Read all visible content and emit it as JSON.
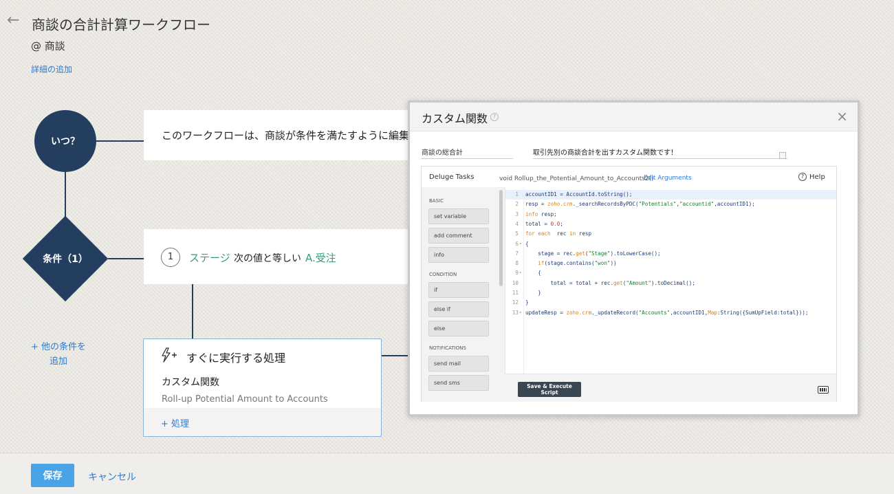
{
  "header": {
    "title": "商談の合計計算ワークフロー",
    "module": "@ 商談",
    "add_details": "詳細の追加"
  },
  "flow": {
    "when_label": "いつ？",
    "when_text": "このワークフローは、商談が条件を満たすように編集",
    "condition_label": "条件（1）",
    "condition": {
      "number": "1",
      "field": "ステージ",
      "operator": "次の値と等しい",
      "value": "A.受注"
    },
    "add_condition": [
      "+ 他の条件を",
      "追加"
    ],
    "action": {
      "title": "すぐに実行する処理",
      "type": "カスタム関数",
      "name": "Roll-up Potential Amount to Accounts",
      "add": "+ 処理"
    }
  },
  "footer": {
    "save": "保存",
    "cancel": "キャンセル"
  },
  "modal": {
    "title": "カスタム関数",
    "help_icon": "?",
    "close": "×",
    "function_name": "商談の総合計",
    "description": "取引先別の商談合計を出すカスタム関数です！",
    "editor": {
      "tasks_title": "Deluge Tasks",
      "signature": "void Rollup_the_Potential_Amount_to_Accounts2()",
      "edit_arguments": "Edit Arguments",
      "help": "Help",
      "execute_button": "Save & Execute Script",
      "sections": [
        {
          "name": "BASIC",
          "items": [
            "set variable",
            "add comment",
            "info"
          ]
        },
        {
          "name": "CONDITION",
          "items": [
            "if",
            "else if",
            "else"
          ]
        },
        {
          "name": "NOTIFICATIONS",
          "items": [
            "send mail",
            "send sms"
          ]
        }
      ],
      "code_lines": [
        {
          "n": "1",
          "fold": "",
          "text": "accountID1 = AccountId.toString();"
        },
        {
          "n": "2",
          "fold": "",
          "text": "resp = zoho.crm._searchRecordsByPDC(\"Potentials\",\"accountid\",accountID1);"
        },
        {
          "n": "3",
          "fold": "",
          "text": "info resp;"
        },
        {
          "n": "4",
          "fold": "",
          "text": "total = 0.0;"
        },
        {
          "n": "5",
          "fold": "",
          "text": "for each  rec in resp"
        },
        {
          "n": "6",
          "fold": "▾",
          "text": "{"
        },
        {
          "n": "7",
          "fold": "",
          "text": "    stage = rec.get(\"Stage\").toLowerCase();"
        },
        {
          "n": "8",
          "fold": "",
          "text": "    if(stage.contains(\"won\"))"
        },
        {
          "n": "9",
          "fold": "▾",
          "text": "    {"
        },
        {
          "n": "10",
          "fold": "",
          "text": "        total = total + rec.get(\"Amount\").toDecimal();"
        },
        {
          "n": "11",
          "fold": "",
          "text": "    }"
        },
        {
          "n": "12",
          "fold": "",
          "text": "}"
        },
        {
          "n": "13",
          "fold": "▾",
          "text": "updateResp = zoho.crm._updateRecord(\"Accounts\",accountID1,Map:String({SumUpField:total}));"
        }
      ]
    }
  },
  "colors": {
    "flow_node": "#243e5f",
    "link": "#2f7bd1",
    "condition_text": "#3a9a7a",
    "save_button": "#4aa3e6"
  }
}
